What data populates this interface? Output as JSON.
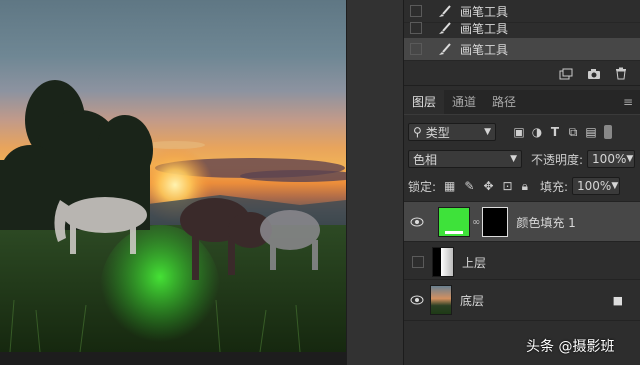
{
  "history": {
    "items": [
      {
        "label": "画笔工具"
      },
      {
        "label": "画笔工具"
      },
      {
        "label": "画笔工具"
      }
    ]
  },
  "layers_panel": {
    "tabs": [
      "图层",
      "通道",
      "路径"
    ],
    "filter_label": "类型",
    "blend_mode": "色相",
    "opacity_label": "不透明度:",
    "opacity_value": "100%",
    "lock_label": "锁定:",
    "fill_label": "填充:",
    "fill_value": "100%",
    "layers": [
      {
        "name": "颜色填充 1",
        "visible": true,
        "fill_color": "#3ee23a"
      },
      {
        "name": "上层",
        "visible": false
      },
      {
        "name": "底层",
        "visible": true,
        "locked": true
      }
    ]
  },
  "watermark": "头条 @摄影班"
}
